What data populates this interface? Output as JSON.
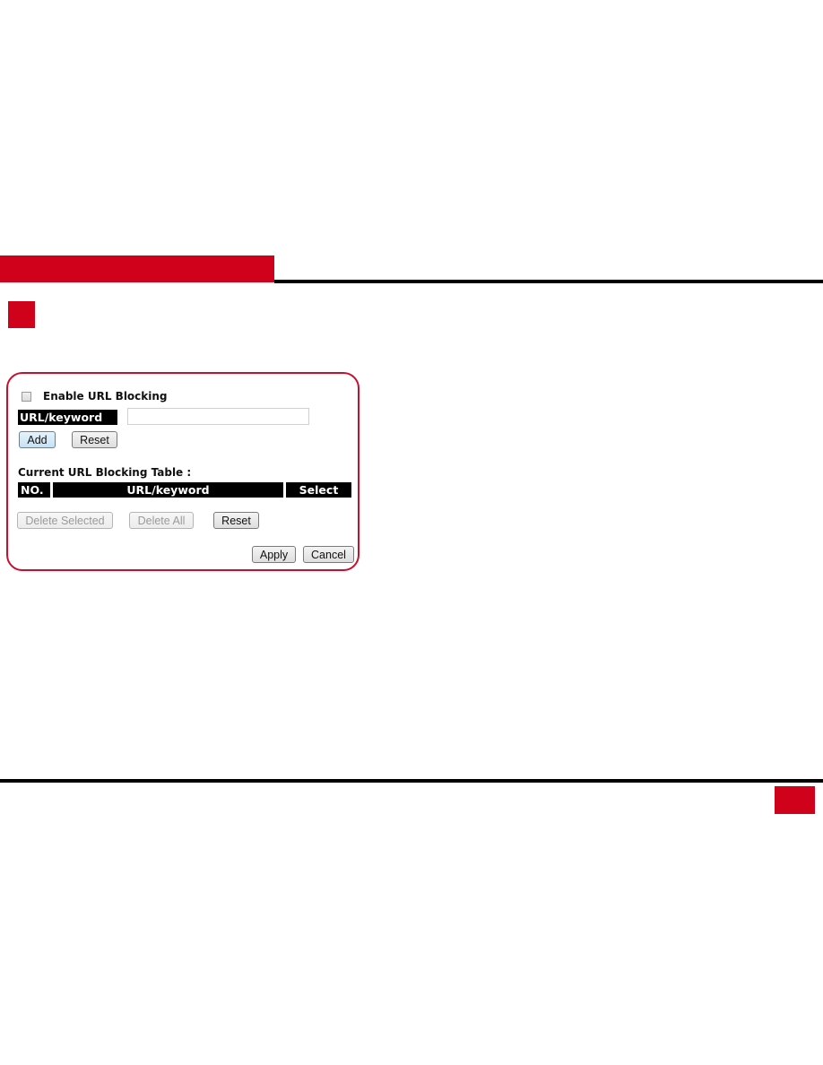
{
  "page": {
    "colors": {
      "accent": "#d0021b",
      "rule": "#000000",
      "panel_border": "#c8102e"
    }
  },
  "url_blocking": {
    "enable_label": "Enable URL Blocking",
    "enable_checked": false,
    "url_keyword_label": "URL/keyword",
    "url_keyword_value": "",
    "add_button": "Add",
    "reset_button": "Reset",
    "table_title": "Current URL Blocking Table :",
    "table_headers": [
      "NO.",
      "URL/keyword",
      "Select"
    ],
    "table_rows": [],
    "delete_selected_button": "Delete Selected",
    "delete_all_button": "Delete All",
    "table_reset_button": "Reset",
    "apply_button": "Apply",
    "cancel_button": "Cancel"
  }
}
